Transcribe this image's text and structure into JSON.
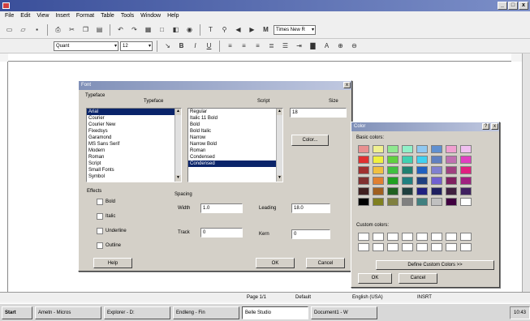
{
  "window": {
    "title": "",
    "min": "_",
    "max": "□",
    "close": "x"
  },
  "menu": [
    "File",
    "Edit",
    "View",
    "Insert",
    "Format",
    "Table",
    "Tools",
    "Window",
    "Help"
  ],
  "toolbar": {
    "font_name": "Times New R",
    "style": "Quant",
    "size": "12"
  },
  "font_dialog": {
    "title": "Font",
    "section_label": "Typeface",
    "typeface_label": "Typeface",
    "script_label": "Script",
    "size_label": "Size",
    "typefaces": [
      "Arial",
      "Courier",
      "Courier New",
      "Fixedsys",
      "Garamond",
      "MS Sans Serif",
      "Modern",
      "Roman",
      "Script",
      "Small Fonts",
      "Symbol"
    ],
    "selected_typeface": "Arial",
    "styles": [
      "Regular",
      "Italic 11 Bold",
      "Bold",
      "Bold Italic",
      "Narrow",
      "Narrow Bold",
      "Roman",
      "Condensed"
    ],
    "selected_style": "Condensed",
    "size_value": "18",
    "color_button": "Color...",
    "effects_label": "Effects",
    "effects": [
      "Bold",
      "Italic",
      "Underline",
      "Outline"
    ],
    "spacing_label": "Spacing",
    "width_label": "Width",
    "width_value": "1.0",
    "leading_label": "Leading",
    "leading_value": "18.0",
    "tracking_label": "Track",
    "tracking_value": "0",
    "kerning_label": "Kern",
    "kerning_value": "0",
    "help_button": "Help",
    "ok_button": "OK",
    "cancel_button": "Cancel"
  },
  "color_dialog": {
    "title": "Color",
    "basic_label": "Basic colors:",
    "custom_label": "Custom colors:",
    "define_button": "Define Custom Colors >>",
    "ok_button": "OK",
    "cancel_button": "Cancel",
    "colors": [
      "#e89090",
      "#f0f090",
      "#90e890",
      "#90f0c8",
      "#90c8f0",
      "#6090d0",
      "#f0a0d0",
      "#f0c0f0",
      "#e03030",
      "#f0f040",
      "#60d040",
      "#40d0b0",
      "#40d0f0",
      "#6080c0",
      "#c070b0",
      "#e040c0",
      "#a03030",
      "#f0c040",
      "#40c040",
      "#208070",
      "#2060c0",
      "#8080d0",
      "#a04080",
      "#e02080",
      "#803030",
      "#e08030",
      "#20a020",
      "#208080",
      "#204080",
      "#7060d0",
      "#802060",
      "#a02080",
      "#402020",
      "#a06020",
      "#206020",
      "#204040",
      "#202080",
      "#202060",
      "#402040",
      "#402060",
      "#000000",
      "#808020",
      "#808040",
      "#808080",
      "#408080",
      "#c0c0c0",
      "#400040",
      "#ffffff"
    ]
  },
  "status": {
    "page": "Page 1/1",
    "style": "Default",
    "lang": "English (USA)",
    "extra": "INSRT"
  },
  "taskbar": {
    "start": "Start",
    "tasks": [
      "Ametn - Micros",
      "Explorer - D:",
      "Endleng - Fin",
      "Belle Studio",
      "Document1 - W"
    ],
    "tray": "10:43"
  }
}
